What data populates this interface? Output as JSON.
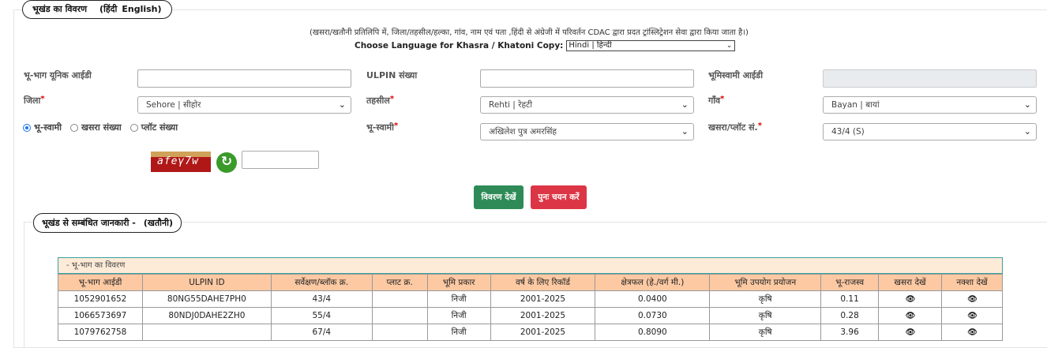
{
  "section": {
    "legend": "भूखंड का विवरण",
    "lang_hindi": "(हिंदी",
    "lang_english": "English)",
    "note": "(खसरा/खतौनी प्रतिलिपि में, जिला/तहसील/हल्का, गांव, नाम एवं पता ,हिंदी से अंग्रेजी में परिवर्तन CDAC द्वारा प्रदत ट्रांस्लिट्रेशन सेवा द्वारा किया जाता है।)",
    "language_label": "Choose Language for Khasra / Khatoni Copy:",
    "language_value": "Hindi | हिन्दी"
  },
  "form": {
    "unique_id_label": "भू-भाग यूनिक आईडी",
    "ulpin_label": "ULPIN संख्या",
    "owner_id_label": "भूमिस्वामी आईडी",
    "district_label": "जिला",
    "district_value": "Sehore | सीहोर",
    "tehsil_label": "तहसील",
    "tehsil_value": "Rehti | रेहटी",
    "village_label": "गाँव",
    "village_value": "Bayan | बायां",
    "radio_owner": "भू-स्वामी",
    "radio_khasra": "खसरा संख्या",
    "radio_plot": "प्लॉट संख्या",
    "owner_label": "भू-स्वामी",
    "owner_value": "अखिलेश पुत्र अमरसिंह",
    "khasra_label": "खसरा/प्लॉट सं.",
    "khasra_value": "43/4 (S)",
    "required_mark": "*",
    "captcha_text": "afeγ7w",
    "view_button": "विवरण देखें",
    "reset_button": "पुनः चयन करें"
  },
  "related": {
    "legend": "भूखंड से सम्बंधित जानकारी -",
    "legend_sub": "(खतौनी)",
    "caption": "- भू-भाग का विवरण",
    "columns": [
      "भू-भाग आईडी",
      "ULPIN ID",
      "सर्वेक्षण/ब्लॉक क्र.",
      "प्लाट क्र.",
      "भूमि प्रकार",
      "वर्ष के लिए रिकॉर्ड",
      "क्षेत्रफल (हे./वर्ग मी.)",
      "भूमि उपयोग प्रयोजन",
      "भू-राजस्व",
      "खसरा देखें",
      "नक्शा देखें"
    ],
    "rows": [
      {
        "id": "1052901652",
        "ulpin": "80NG55DAHE7PH0",
        "survey": "43/4",
        "plot": "",
        "type": "निजी",
        "year": "2001-2025",
        "area": "0.0400",
        "use": "कृषि",
        "revenue": "0.11",
        "khasra": "👁",
        "map": "👁"
      },
      {
        "id": "1066573697",
        "ulpin": "80NDJ0DAHE2ZH0",
        "survey": "55/4",
        "plot": "",
        "type": "निजी",
        "year": "2001-2025",
        "area": "0.0730",
        "use": "कृषि",
        "revenue": "0.28",
        "khasra": "👁",
        "map": "👁"
      },
      {
        "id": "1079762758",
        "ulpin": "",
        "survey": "67/4",
        "plot": "",
        "type": "निजी",
        "year": "2001-2025",
        "area": "0.8090",
        "use": "कृषि",
        "revenue": "3.96",
        "khasra": "👁",
        "map": "👁"
      }
    ]
  }
}
